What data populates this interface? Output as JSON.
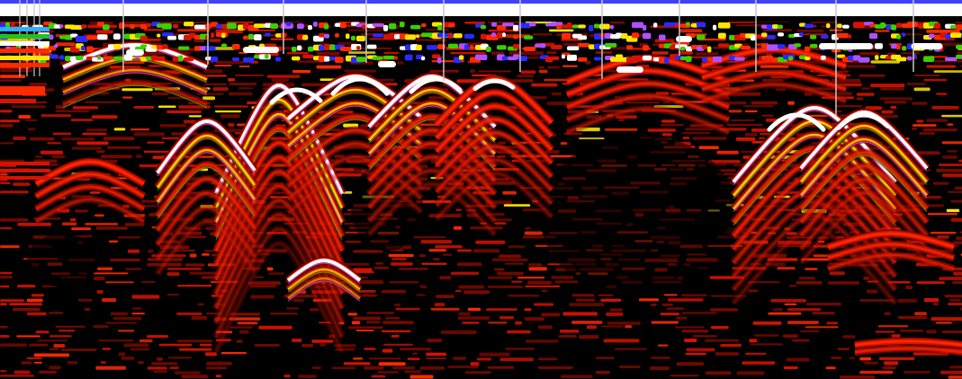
{
  "palette": {
    "background": "#000000",
    "dark_red": "#7a0a00",
    "red": "#d81200",
    "bright_red": "#ff2a00",
    "yellow": "#ffe600",
    "green": "#3ad000",
    "blue": "#2a2aff",
    "purple": "#b050ff",
    "white": "#ffffff",
    "marker_line": "#c8c8c8"
  },
  "legend_bands": [
    "#2ab0ff",
    "#22c022",
    "#ffffff",
    "#ff2a00",
    "#ffe600",
    "#ff2a00"
  ]
}
